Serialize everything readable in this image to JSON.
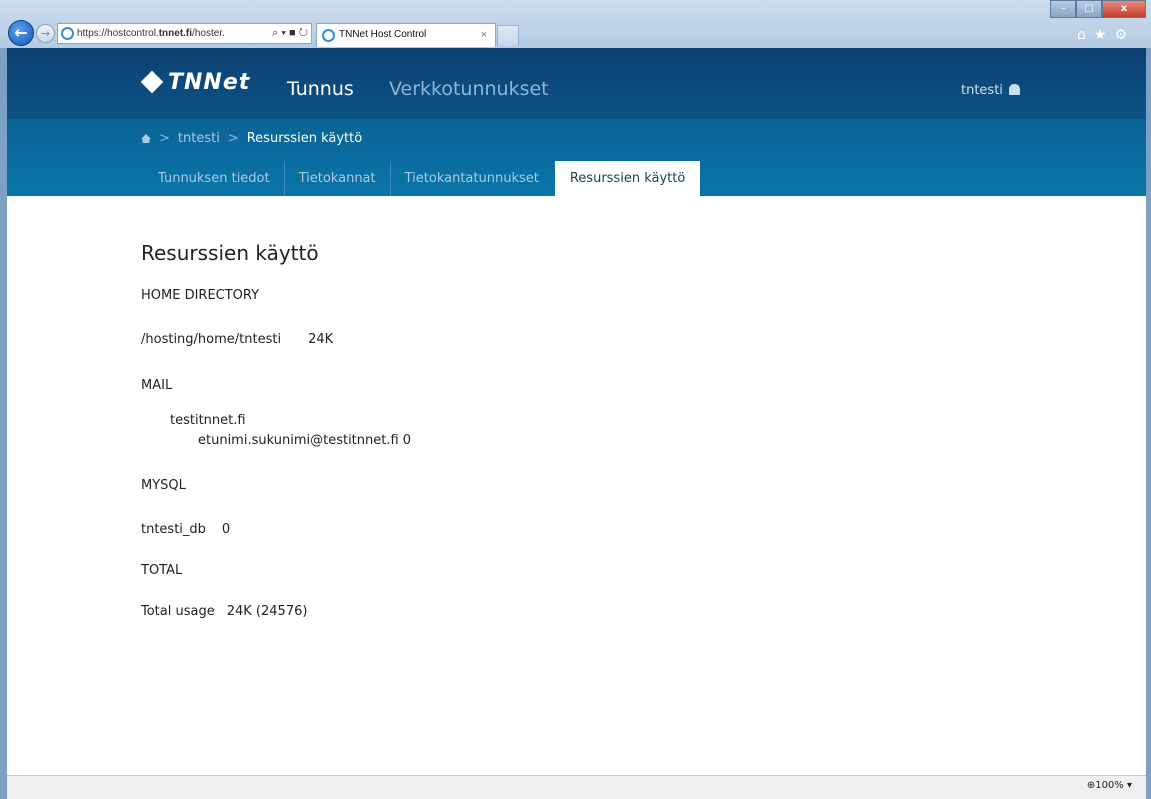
{
  "browser": {
    "address": "https://hostcontrol.tnnet.fi/hoster.",
    "address_host_bold": "tnnet.fi",
    "tab_title": "TNNet Host Control",
    "zoom": "100%",
    "window_controls": {
      "minimize": "–",
      "maximize": "□",
      "close": "x"
    }
  },
  "header": {
    "logo": "TNNet",
    "nav_main": "Tunnus",
    "nav_secondary": "Verkkotunnukset",
    "user": "tntesti"
  },
  "breadcrumb": {
    "items": [
      "tntesti",
      "Resurssien käyttö"
    ]
  },
  "tabs": [
    "Tunnuksen tiedot",
    "Tietokannat",
    "Tietokantatunnukset",
    "Resurssien käyttö"
  ],
  "active_tab": "Resurssien käyttö",
  "page": {
    "title": "Resurssien käyttö",
    "home_heading": "HOME DIRECTORY",
    "home_path": "/hosting/home/tntesti",
    "home_size": "24K",
    "mail_heading": "MAIL",
    "mail_domain": "testitnnet.fi",
    "mail_account": "etunimi.sukunimi@testitnnet.fi 0",
    "mysql_heading": "MYSQL",
    "mysql_db": "tntesti_db",
    "mysql_size": "0",
    "total_heading": "TOTAL",
    "total_label": "Total usage",
    "total_value": "24K (24576)"
  }
}
